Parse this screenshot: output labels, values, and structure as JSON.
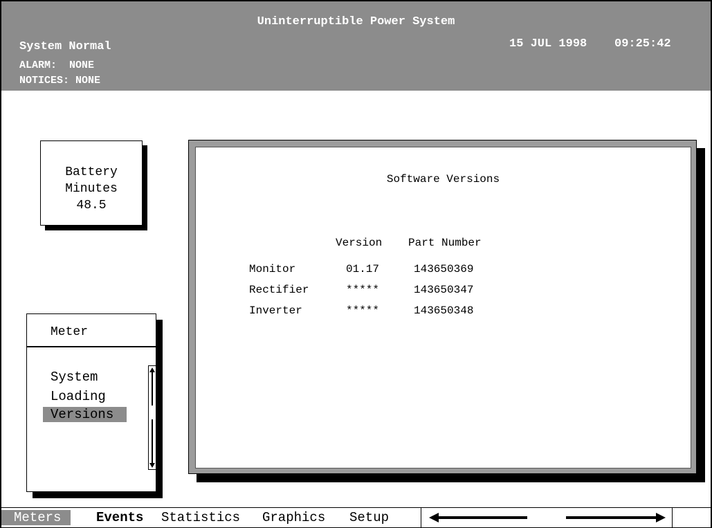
{
  "header": {
    "title": "Uninterruptible Power System",
    "status": "System Normal",
    "date": "15 JUL 1998",
    "time": "09:25:42",
    "alarm": "ALARM:  NONE",
    "notices": "NOTICES: NONE"
  },
  "battery": {
    "line1": "Battery",
    "line2": "Minutes",
    "value": "48.5"
  },
  "software_versions": {
    "title": "Software Versions",
    "columns": {
      "version": "Version",
      "part_number": "Part Number"
    },
    "rows": [
      {
        "name": "Monitor",
        "version": "01.17",
        "part_number": "143650369"
      },
      {
        "name": "Rectifier",
        "version": "*****",
        "part_number": "143650347"
      },
      {
        "name": "Inverter",
        "version": "*****",
        "part_number": "143650348"
      }
    ]
  },
  "meter_panel": {
    "title": "Meter",
    "items": [
      "System",
      "Loading",
      "Versions"
    ],
    "selected": "Versions"
  },
  "nav": {
    "items": [
      "Meters",
      "Events",
      "Statistics",
      "Graphics",
      "Setup"
    ],
    "active": "Meters"
  },
  "colors": {
    "gray": "#8c8c8c",
    "black": "#000000",
    "white": "#ffffff"
  }
}
